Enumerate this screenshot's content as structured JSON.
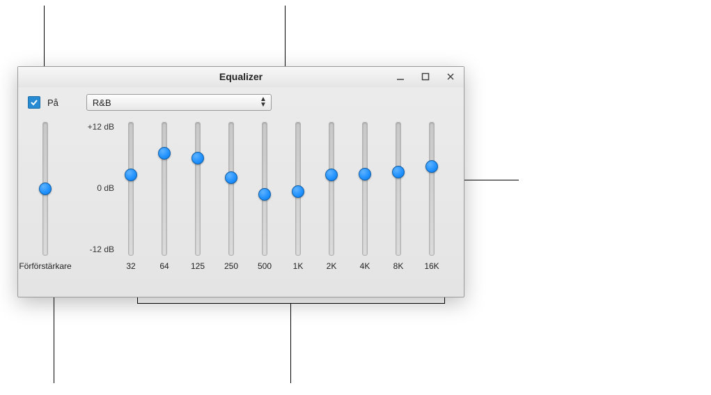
{
  "window": {
    "title": "Equalizer"
  },
  "toolbar": {
    "on_checkbox_checked": true,
    "on_label": "På",
    "preset_selected": "R&B"
  },
  "scale": {
    "max_label": "+12 dB",
    "mid_label": "0 dB",
    "min_label": "-12 dB"
  },
  "preamp": {
    "label": "Förförstärkare",
    "value_db": 0
  },
  "bands": [
    {
      "freq_label": "32",
      "value_db": 2.5
    },
    {
      "freq_label": "64",
      "value_db": 6.5
    },
    {
      "freq_label": "125",
      "value_db": 5.5
    },
    {
      "freq_label": "250",
      "value_db": 2.0
    },
    {
      "freq_label": "500",
      "value_db": -1.0
    },
    {
      "freq_label": "1K",
      "value_db": -0.5
    },
    {
      "freq_label": "2K",
      "value_db": 2.5
    },
    {
      "freq_label": "4K",
      "value_db": 2.7
    },
    {
      "freq_label": "8K",
      "value_db": 3.0
    },
    {
      "freq_label": "16K",
      "value_db": 4.0
    }
  ],
  "range_db": 12
}
